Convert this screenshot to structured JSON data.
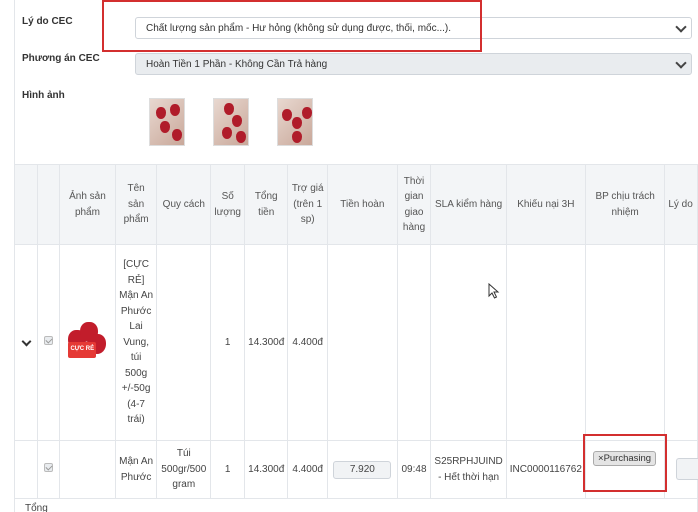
{
  "form": {
    "reason_label": "Lý do CEC",
    "reason_value": "Chất lượng sản phẩm - Hư hỏng (không sử dụng được, thối, mốc...).",
    "plan_label": "Phương án CEC",
    "plan_value": "Hoàn Tiền 1 Phần - Không Cần Trả hàng",
    "images_label": "Hình ảnh"
  },
  "table": {
    "headers": [
      "",
      "",
      "Ảnh sản phẩm",
      "Tên sản phẩm",
      "Quy cách",
      "Số lượng",
      "Tổng tiền",
      "Trợ giá (trên 1 sp)",
      "Tiền hoàn",
      "Thời gian giao hàng",
      "SLA kiểm hàng",
      "Khiếu nại 3H",
      "BP chịu trách nhiệm",
      "Lý do"
    ],
    "main_row": {
      "name": "[CỰC RẺ] Mận An Phước Lai Vung, túi 500g +/-50g (4-7 trái)",
      "qty": "1",
      "total": "14.300đ",
      "subsidy": "4.400đ",
      "image_tag": "CỰC RẺ"
    },
    "sub_row": {
      "name": "Mận An Phước",
      "spec": "Túi 500gr/500 gram",
      "qty": "1",
      "total": "14.300đ",
      "subsidy": "4.400đ",
      "refund": "7.920",
      "delivery_time": "09:48",
      "sla": "S25RPHJUIND - Hết thời hạn",
      "complaint": "INC0000116762",
      "department_tag": "Purchasing",
      "tag_remove": "×"
    },
    "footer_label": "Tổng"
  },
  "colors": {
    "highlight": "#d32f2f",
    "fruit": "#b01c2a"
  }
}
